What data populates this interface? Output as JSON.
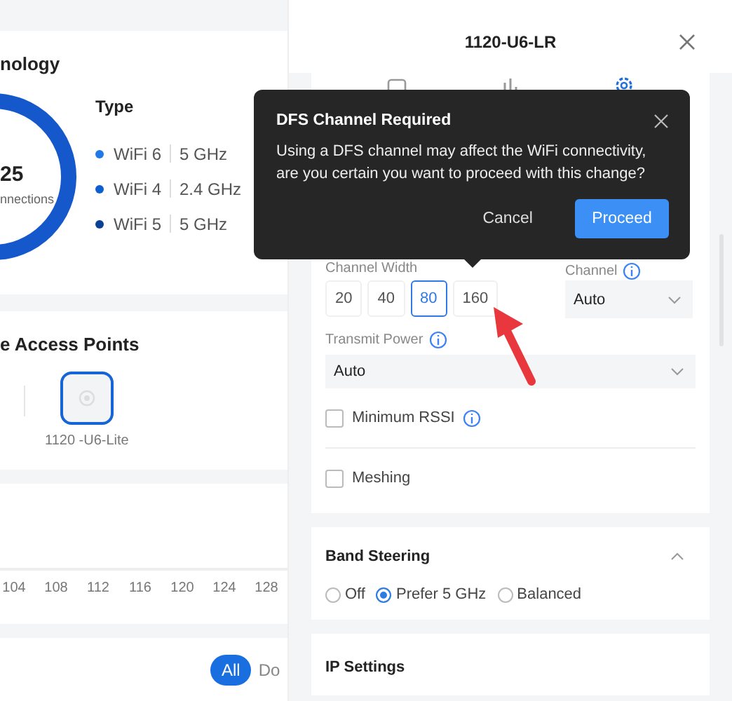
{
  "technology": {
    "title": "nology",
    "count": "25",
    "count_label": "nnections",
    "type_title": "Type",
    "types": [
      {
        "name": "WiFi 6",
        "band": "5 GHz",
        "color": "#1f7ae8"
      },
      {
        "name": "WiFi 4",
        "band": "2.4 GHz",
        "color": "#0b5fd0"
      },
      {
        "name": "WiFi 5",
        "band": "5 GHz",
        "color": "#0c3f96"
      }
    ]
  },
  "access_points": {
    "title": "e Access Points",
    "items": [
      {
        "label": "1120 -U6-Lite",
        "selected": true
      }
    ]
  },
  "channel_axis": [
    "104",
    "108",
    "112",
    "116",
    "120",
    "124",
    "128"
  ],
  "filters": [
    {
      "label": "All",
      "selected": true
    },
    {
      "label": "Do",
      "selected": false
    }
  ],
  "panel": {
    "title": "1120-U6-LR",
    "channel_width": {
      "label": "Channel Width",
      "options": [
        {
          "label": "20",
          "selected": false
        },
        {
          "label": "40",
          "selected": false
        },
        {
          "label": "80",
          "selected": true
        },
        {
          "label": "160",
          "selected": false
        }
      ]
    },
    "channel": {
      "label": "Channel",
      "value": "Auto"
    },
    "transmit_power": {
      "label": "Transmit Power",
      "value": "Auto"
    },
    "options": [
      {
        "label": "Minimum RSSI",
        "checked": false,
        "info": true
      },
      {
        "label": "Meshing",
        "checked": false,
        "info": false
      }
    ],
    "band_steering": {
      "title": "Band Steering",
      "expanded": true,
      "choices": [
        {
          "label": "Off",
          "selected": false
        },
        {
          "label": "Prefer 5 GHz",
          "selected": true
        },
        {
          "label": "Balanced",
          "selected": false
        }
      ]
    },
    "ip_settings": {
      "title": "IP Settings"
    }
  },
  "dialog": {
    "title": "DFS Channel Required",
    "message": "Using a DFS channel may affect the WiFi connectivity, are you certain you want to proceed with this change?",
    "buttons": [
      {
        "label": "Cancel",
        "kind": "text"
      },
      {
        "label": "Proceed",
        "kind": "primary"
      }
    ]
  }
}
